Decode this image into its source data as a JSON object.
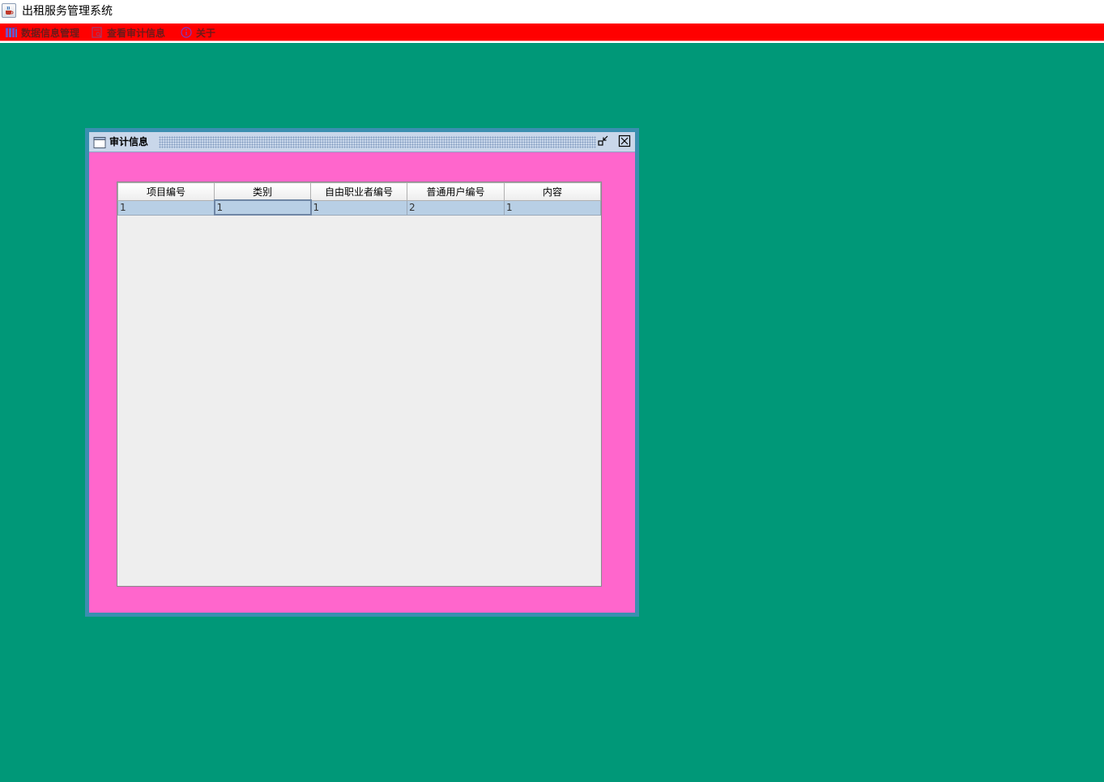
{
  "window": {
    "title": "出租服务管理系统",
    "app_icon": "java-cup-icon"
  },
  "menubar": {
    "background": "#ff0000",
    "items": [
      {
        "label": "数据信息管理",
        "icon": "database-icon"
      },
      {
        "label": "查看审计信息",
        "icon": "document-view-icon"
      },
      {
        "label": "关于",
        "icon": "info-icon"
      }
    ]
  },
  "desktop": {
    "background": "#009878"
  },
  "internal_frame": {
    "title": "审计信息",
    "background": "#ff66cc",
    "border_color": "#3a8fb0",
    "table": {
      "columns": [
        "项目编号",
        "类别",
        "自由职业者编号",
        "普通用户编号",
        "内容"
      ],
      "rows": [
        [
          "1",
          "1",
          "1",
          "2",
          "1"
        ]
      ],
      "selected_row_color": "#b8cfe5"
    }
  }
}
